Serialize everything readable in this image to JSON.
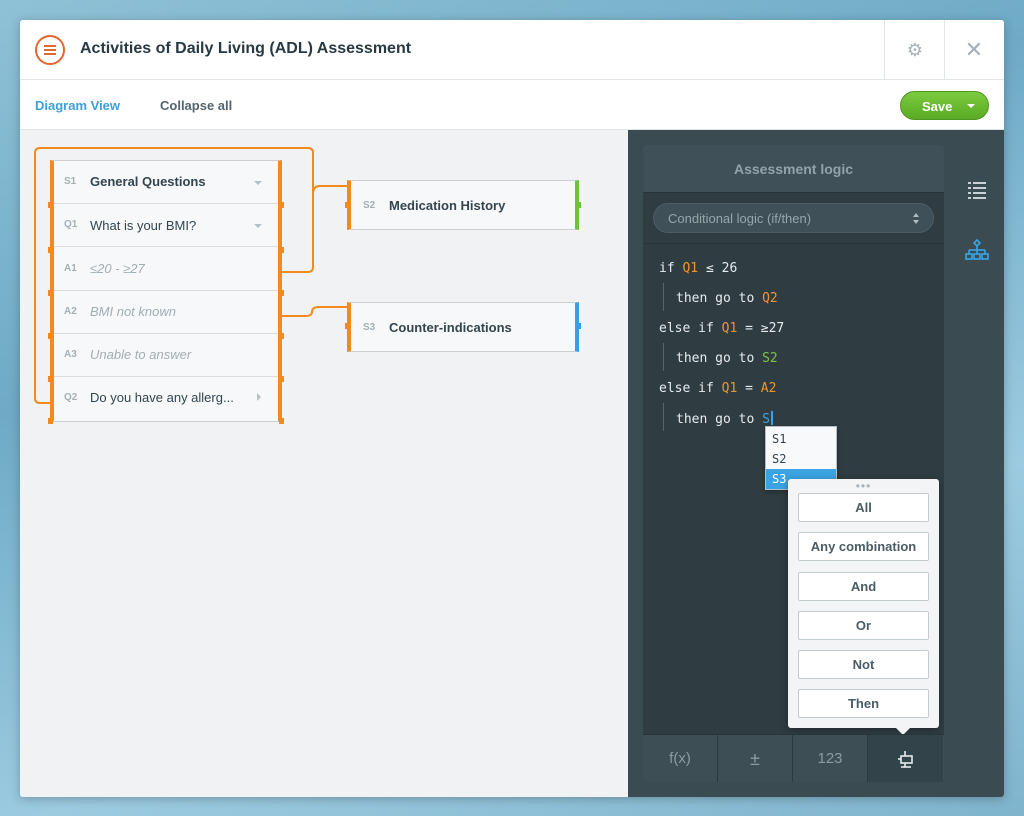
{
  "window": {
    "title": "Activities of Daily Living (ADL) Assessment"
  },
  "toolbar": {
    "diagram_view": "Diagram View",
    "collapse_all": "Collapse all",
    "save": "Save"
  },
  "diagram": {
    "section_main": {
      "tag": "S1",
      "label": "General Questions"
    },
    "rows": [
      {
        "tag": "Q1",
        "label": "What is your BMI?"
      },
      {
        "tag": "A1",
        "label": "≤20 - ≥27"
      },
      {
        "tag": "A2",
        "label": "BMI not known"
      },
      {
        "tag": "A3",
        "label": "Unable to answer"
      },
      {
        "tag": "Q2",
        "label": "Do you have any allerg..."
      }
    ],
    "s2": {
      "tag": "S2",
      "label": "Medication History"
    },
    "s3": {
      "tag": "S3",
      "label": "Counter-indications"
    }
  },
  "logic_panel": {
    "title": "Assessment logic",
    "mode": "Conditional logic (if/then)",
    "code": {
      "l1": {
        "kw": "if",
        "var": "Q1",
        "op": "≤ 26"
      },
      "l2": {
        "kw": "then go to",
        "target": "Q2"
      },
      "l3": {
        "kw": "else if",
        "var": "Q1",
        "op": "= ≥27"
      },
      "l4": {
        "kw": "then go to",
        "target": "S2"
      },
      "l5": {
        "kw": "else if",
        "var": "Q1",
        "op": "=",
        "val": "A2"
      },
      "l6": {
        "kw": "then go to",
        "target": "S"
      }
    },
    "autocomplete": [
      "S1",
      "S2",
      "S3"
    ],
    "autocomplete_selected": "S3",
    "operators": [
      "All",
      "Any combination",
      "And",
      "Or",
      "Not",
      "Then"
    ],
    "bottom_tabs": [
      "f(x)",
      "±",
      "123"
    ]
  },
  "colors": {
    "accent_orange": "#f28a20",
    "accent_green": "#6cc23a",
    "accent_blue": "#3a9fe1",
    "save_green": "#5aaa25"
  }
}
